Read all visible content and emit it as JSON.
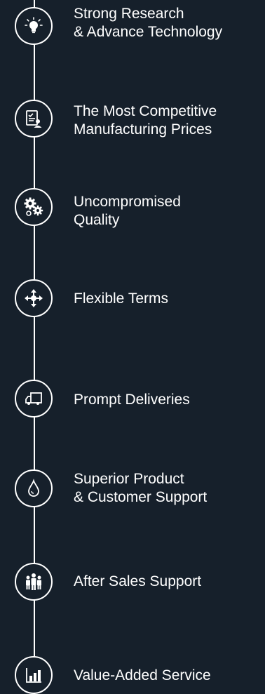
{
  "features": [
    {
      "icon": "lightbulb-icon",
      "line1": "Strong Research",
      "line2": "& Advance Technology"
    },
    {
      "icon": "document-user-icon",
      "line1": "The Most Competitive",
      "line2": "Manufacturing Prices"
    },
    {
      "icon": "gears-icon",
      "line1": "Uncompromised",
      "line2": "Quality"
    },
    {
      "icon": "move-arrows-icon",
      "line1": "Flexible Terms",
      "line2": ""
    },
    {
      "icon": "truck-icon",
      "line1": "Prompt Deliveries",
      "line2": ""
    },
    {
      "icon": "drop-icon",
      "line1": "Superior Product",
      "line2": "& Customer Support"
    },
    {
      "icon": "team-icon",
      "line1": "After Sales Support",
      "line2": ""
    },
    {
      "icon": "bar-chart-icon",
      "line1": "Value-Added Service",
      "line2": ""
    }
  ],
  "colors": {
    "background": "#16202b",
    "foreground": "#ffffff"
  }
}
